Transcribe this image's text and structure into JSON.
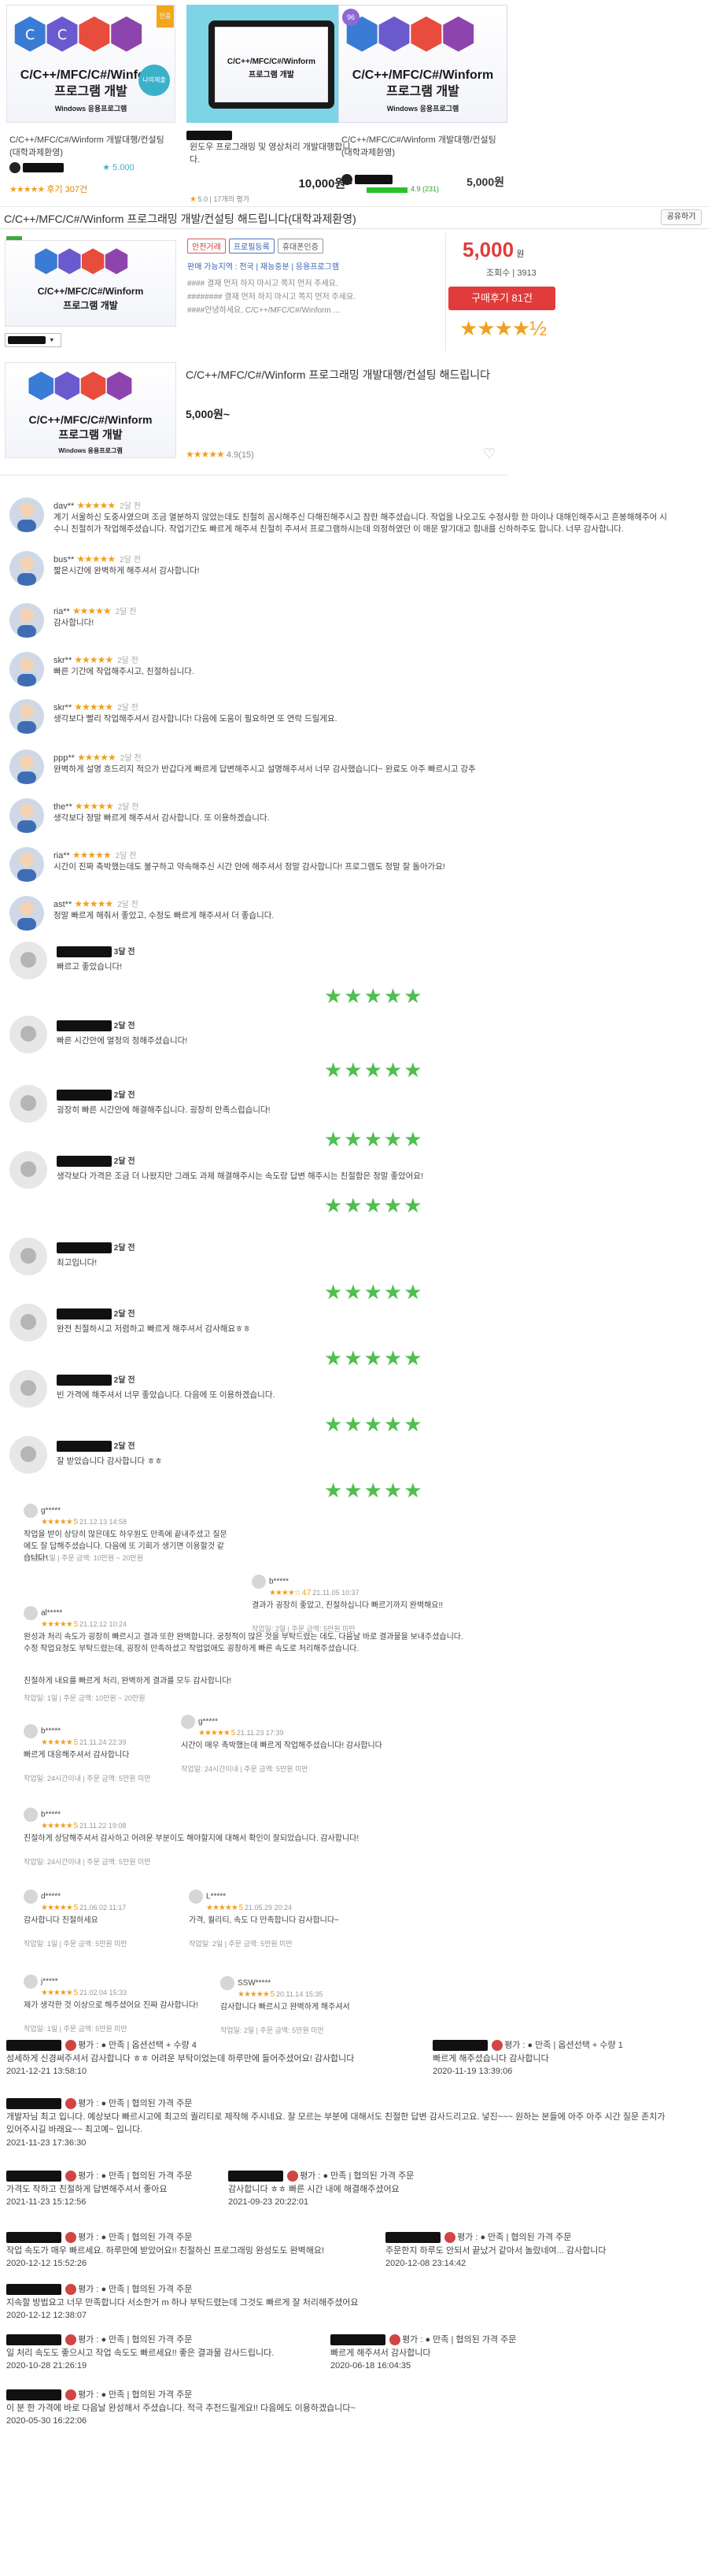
{
  "logo": {
    "title": "C/C++/MFC/C#/Winform",
    "title2": "프로그램 개발",
    "sub": "Windows 응용프로그램"
  },
  "cards": [
    {
      "title": "C/C++/MFC/C#/Winform 개발대행/컨설팅(대학과제환영)",
      "rating": "5.000",
      "reviews": "후기 307건",
      "badge": "나의제출",
      "ribbon": "인증"
    },
    {
      "title": "윈도우 프로그래밍 및 영상처리 개발대행합니다.",
      "price": "10,000원~",
      "rating": "5.0",
      "reviews": "17개의 평가"
    },
    {
      "title": "C/C++/MFC/C#/Winform 개발대행/컨설팅(대학과제환영)",
      "price": "5,000원",
      "rating": "4.9 (231)",
      "level": "96"
    }
  ],
  "section_title": "C/C++/MFC/C#/Winform 프로그래밍 개발/컨설팅 해드립니다(대학과제환영)",
  "share_label": "공유하기",
  "listing": {
    "tags": [
      "안전거래",
      "프로필등록",
      "휴대폰인증"
    ],
    "info": [
      "판매 가능지역 : 전국",
      "재능중분",
      "응용프로그램"
    ],
    "desc": [
      "#### 결재 먼저 하지 마시고 쪽지 먼저 주세요.",
      "######## 결재 먼저 하지 마시고 쪽지 먼저 주세요.",
      "####안녕하세요, C/C++/MFC/C#/Winform ..."
    ],
    "price": "5,000",
    "price_unit": "원",
    "views": "조회수 | 3913",
    "buy": "구매후기 81건",
    "stars": "★★★★½"
  },
  "main": {
    "title": "C/C++/MFC/C#/Winform 프로그래밍 개발대행/컨설팅 해드립니다",
    "price": "5,000원~",
    "stars": "★★★★★",
    "rating": "4.9(15)"
  },
  "reviews": [
    {
      "user": "dav**",
      "date": "2달 전",
      "text": "계기 서울하신 도중사였으며 조금 열분하지 않았는데도 친철히 꼼시해주신 다해진해주시고 참한 해주셨습니다. 작업을 나오고도 수정사항 한 마이나 대해인해주시고 흔봉해해주어 시수니 친절히가 작업해주셨습니다. 작업기간도 빠르게 해주셔 친절히 주셔서 프로그램하시는데 의정하였던 이 매문 말기대고 힘내를 신하하주도 합니다. 너무 감사합니다."
    },
    {
      "user": "bus**",
      "date": "2달 전",
      "text": "짧은시간에 완벽하게 해주셔서 감사합니다!"
    },
    {
      "user": "ria**",
      "date": "2달 전",
      "text": "감사합니다!"
    },
    {
      "user": "skr**",
      "date": "2달 전",
      "text": "빠른 기간에 작업해주시고, 친절하십니다."
    },
    {
      "user": "skr**",
      "date": "2달 전",
      "text": "생각보다 빨리 작업해주셔서 감사합니다! 다음에 도움이 필요하면 또 연락 드릴게요."
    },
    {
      "user": "ppp**",
      "date": "2달 전",
      "text": "완벽하게 설명 흐드리지 적으가 반갑다게 빠르게 답변해주시고 설명해주셔서 너무 감사했습니다~ 완료도 아주 빠르시고 강추"
    },
    {
      "user": "the**",
      "date": "2달 전",
      "text": "생각보다 정말 빠르게 해주셔서 감사합니다. 또 이용하겠습니다."
    },
    {
      "user": "ria**",
      "date": "2달 전",
      "text": "시간이 진짜 촉박했는데도 불구하고 약속해주신 시간 안에 해주셔서 정말 감사합니다! 프로그램도 정말 잘 돌아가요!"
    },
    {
      "user": "ast**",
      "date": "2달 전",
      "text": "정말 빠르게 해줘서 좋았고, 수정도 빠르게 해주셔서 더 좋습니다."
    }
  ],
  "reviews2": [
    {
      "date": "3달 전",
      "text": "빠르고 좋았습니다!",
      "stars": "★★★★★"
    },
    {
      "date": "2달 전",
      "text": "빠른 시간안에 열정의 정해주셨습니다!",
      "stars": "★★★★★"
    },
    {
      "date": "2달 전",
      "text": "굉장히 빠른 시간안에 해결해주십니다. 굉장히 만족스럽습니다!",
      "stars": "★★★★★"
    },
    {
      "date": "2달 전",
      "text": "생각보다 가격은 조금 더 나왔지만 그래도 과제 해결해주시는 속도랑 답변 해주시는 친절함은 정말 좋았어요!",
      "stars": "★★★★★"
    },
    {
      "date": "2달 전",
      "text": "최고입니다!",
      "stars": "★★★★★"
    },
    {
      "date": "2달 전",
      "text": "완전 친절하시고 저렴하고 빠르게 해주셔서 감사해요ㅎㅎ",
      "stars": "★★★★★"
    },
    {
      "date": "2달 전",
      "text": "빈 가격에 해주셔서 너무 좋았습니다. 다음에 또 이용하겠습니다.",
      "stars": "★★★★★"
    },
    {
      "date": "2달 전",
      "text": "잘 받았습니다 감사합니다 ㅎㅎ",
      "stars": "★★★★★"
    }
  ],
  "mini": [
    {
      "user": "g*****",
      "stars": "★★★★★ 5",
      "date": "21.12.13 14:58",
      "text": "작업을 받이 상당히 많은데도 하우원도 만족에 끝내주셨고 질문에도 잘 답해주셨습니다. 다음에 또 기회가 생기면 이용할것 같습니다!",
      "foot": "작업일 1일 | 주문 금액: 10만원 ~ 20만원"
    },
    {
      "user": "b*****",
      "stars": "★★★★☆ 4.7",
      "date": "21.11.05 10:37",
      "text": "결과가 굉장히 좋았고, 친절하십니다 빠르기까지 완벽해요!!",
      "foot": "작업일: 2일 | 주문 금액: 5만원 미만"
    },
    {
      "user": "al*****",
      "stars": "★★★★★ 5",
      "date": "21.12.12 10:24",
      "text": "완성과 처리 속도가 굉장히 빠르시고 결과 또한 완벽합니다. 궁정적이 많은 것을 부탁드렸는 데도, 다음날 바로 결과물을 보내주셨습니다. 수정 작업요청도 부탁드렸는데, 굉장히 만족하셨고 작업없애도 굉장하게 빠른 속도로 처리해주셨습니다.",
      "foot": ""
    },
    {
      "user": "",
      "stars": "",
      "date": "",
      "text": "친절하게 내요를 빠르게 처리, 완벽하게 결과를 모두 감사합니다!",
      "foot": "작업일: 1일 | 주문 금액: 10만원 ~ 20만원"
    },
    {
      "user": "b*****",
      "stars": "★★★★★ 5",
      "date": "21.11.24 22:39",
      "text": "빠르게 대응해주셔서 감사합니다",
      "foot": "작업일: 24시간이내 | 주문 금액: 5만원 미만"
    },
    {
      "user": "g*****",
      "stars": "★★★★★ 5",
      "date": "21.11.23 17:39",
      "text": "시간이 매우 촉박했는데 빠르게 작업해주셨습니다! 감사합니다",
      "foot": "작업일: 24시간이내 | 주문 금액: 5만원 미만"
    },
    {
      "user": "b*****",
      "stars": "★★★★★ 5",
      "date": "21.11.22 19:08",
      "text": "친절하게 상담해주셔서 감사하고 어려운 부분이도 해야할지에 대해서 확인이 잘되었습니다. 감사합니다!",
      "foot": "작업일: 24시간이내 | 주문 금액: 5만원 미만"
    },
    {
      "user": "d*****",
      "stars": "★★★★★ 5",
      "date": "21.06.02 11:17",
      "text": "감사합니다 친절하세요",
      "foot": "작업일: 1일 | 주문 금액: 5만원 미만"
    },
    {
      "user": "L*****",
      "stars": "★★★★★ 5",
      "date": "21.05.29 20:24",
      "text": "가격, 퀄리티, 속도 다 만족합니다 감사합니다~",
      "foot": "작업일: 2일 | 주문 금액: 5만원 미만"
    },
    {
      "user": "j*****",
      "stars": "★★★★★ 5",
      "date": "21.02.04 15:33",
      "text": "제가 생각한 것 이상으로 해주셨어요 진짜 감사합니다!",
      "foot": "작업일: 1일 | 주문 금액: 5만원 미만"
    },
    {
      "user": "SSW*****",
      "stars": "★★★★★ 5",
      "date": "20.11.14 15:35",
      "text": "감사합니다 빠르시고 완벽하게 해주셔서",
      "foot": "작업일: 2일 | 주문 금액: 5만원 미만"
    }
  ],
  "bottom": [
    {
      "head": "평가 : ● 만족 | 옵션선택 + 수량 4",
      "body": "섬세하게 신경써주셔서 감사합니다 ㅎㅎ 어려운 부탁이었는데 하루만에 들어주셨어요! 감사합니다",
      "date": "2021-12-21 13:58:10"
    },
    {
      "head": "평가 : ● 만족 | 옵션선택 + 수량 1",
      "body": "빠르게 해주셨습니다 감사합니다",
      "date": "2020-11-19 13:39:06"
    },
    {
      "head": "평가 : ● 만족 | 협의된 가격 주문",
      "body": "개발자님 최고 입니다. 예상보다 빠르시고에 최고의 퀄리티로 제작해 주시네요. 잘 모르는 부분에 대해서도 친절한 답변 감사드리고요. 넣진~~~ 원하는 본들에 아주 아주 시간 질문 존치가 있어주시길 바래요~~ 최고예~ 입니다.",
      "date": "2021-11-23 17:36:30"
    },
    {
      "head": "평가 : ● 만족 | 협의된 가격 주문",
      "body": "가격도 착하고 친절하게 답변해주셔서 좋아요",
      "date": "2021-11-23 15:12:56"
    },
    {
      "head": "평가 : ● 만족 | 협의된 가격 주문",
      "body": "감사합니다 ㅎㅎ 빠른 시간 내에 해결해주셨어요",
      "date": "2021-09-23 20:22:01"
    },
    {
      "head": "평가 : ● 만족 | 협의된 가격 주문",
      "body": "작업 속도가 매우 빠르세요. 하루만에 받았어요!! 친절하신 프로그래밍 완성도도 완벽해요!",
      "date": "2020-12-12 15:52:26"
    },
    {
      "head": "평가 : ● 만족 | 협의된 가격 주문",
      "body": "주문한지 하루도 안되서 끝났거 같아서 놀랐네여... 감사합니다",
      "date": "2020-12-08 23:14:42"
    },
    {
      "head": "평가 : ● 만족 | 협의된 가격 주문",
      "body": "지속할 방법요고 너무 만족합니다 서소한거 m 하나 부탁드렸는데 그것도 빠르게 잘 처리해주셨어요",
      "date": "2020-12-12 12:38:07"
    },
    {
      "head": "평가 : ● 만족 | 협의된 가격 주문",
      "body": "일 처리 속도도 좋으시고 작업 속도도 빠르세요!! 좋은 결과물 감사드립니다.",
      "date": "2020-10-28 21:26:19"
    },
    {
      "head": "평가 : ● 만족 | 협의된 가격 주문",
      "body": "빠르게 해주셔서 감사합니다",
      "date": "2020-06-18 16:04:35"
    },
    {
      "head": "평가 : ● 만족 | 협의된 가격 주문",
      "body": "이 분 한 가격에 바로 다음날 완성해서 주셨습니다. 적극 추천드릴게요!! 다음에도 이용하겠습니다~",
      "date": "2020-05-30 16:22:06"
    }
  ]
}
